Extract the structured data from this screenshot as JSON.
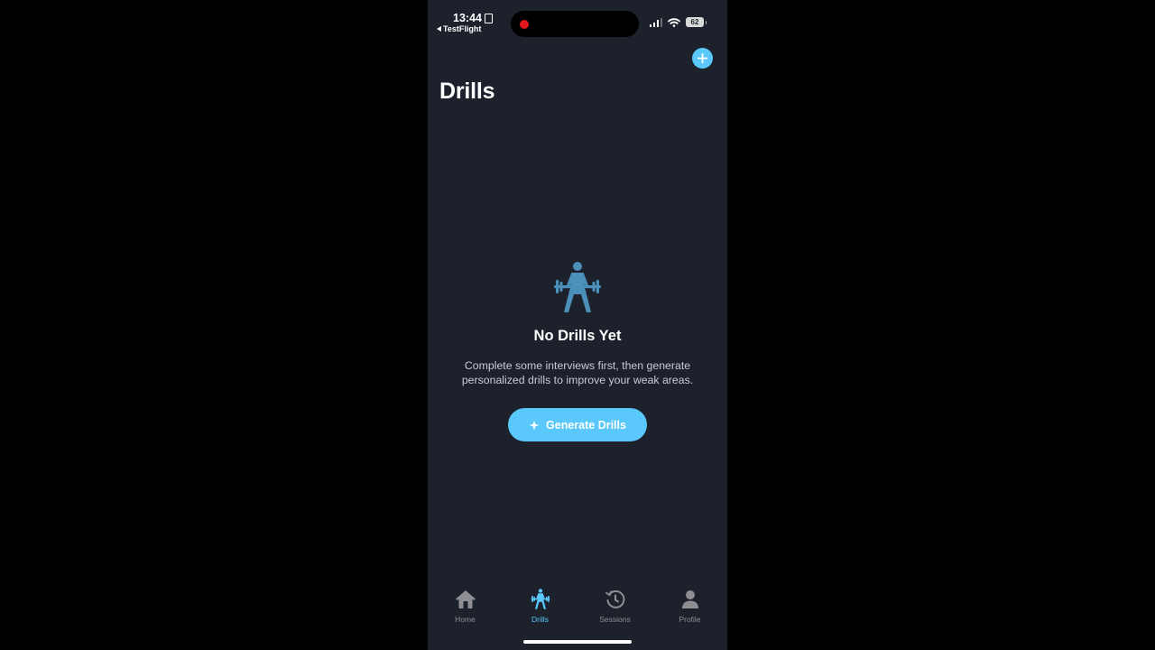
{
  "status_bar": {
    "time": "13:44",
    "back_app": "TestFlight",
    "battery": "62"
  },
  "header": {
    "title": "Drills",
    "add_icon": "plus-icon"
  },
  "empty_state": {
    "icon": "weightlifter-icon",
    "title": "No Drills Yet",
    "description_lines": [
      "Complete some interviews first, then generate",
      "personalized drills to improve your weak areas."
    ],
    "button_label": "Generate Drills",
    "button_icon": "sparkle-icon"
  },
  "tab_bar": {
    "active": "Drills",
    "tabs": [
      {
        "label": "Home",
        "icon": "house-icon"
      },
      {
        "label": "Drills",
        "icon": "weightlifter-icon"
      },
      {
        "label": "Sessions",
        "icon": "history-clock-icon"
      },
      {
        "label": "Profile",
        "icon": "person-icon"
      }
    ]
  },
  "colors": {
    "background": "#1c212c",
    "accent": "#5ac8fa",
    "icon_muted": "#4a90b8",
    "tab_inactive": "#8e8e93",
    "recording": "#e0181e"
  }
}
